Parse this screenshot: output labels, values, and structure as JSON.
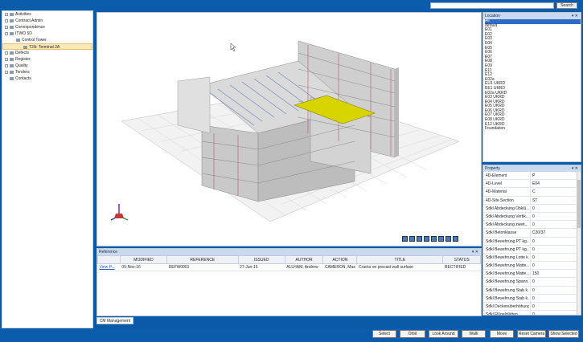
{
  "search": {
    "button": "Search",
    "value": ""
  },
  "tree": [
    {
      "label": "Activities",
      "level": 0
    },
    {
      "label": "Contract Admin",
      "level": 0
    },
    {
      "label": "Correspondence",
      "level": 0
    },
    {
      "label": "ITWO 5D",
      "level": 0
    },
    {
      "label": "Control Tower",
      "level": 1
    },
    {
      "label": "T2A: Terminal 2A",
      "level": 2,
      "selected": true
    },
    {
      "label": "Defects",
      "level": 0
    },
    {
      "label": "Register",
      "level": 0
    },
    {
      "label": "Quality",
      "level": 0
    },
    {
      "label": "Tenders",
      "level": 0
    },
    {
      "label": "Contacts",
      "level": 0
    }
  ],
  "location": {
    "title": "Location",
    "items": [
      "All",
      "default",
      "E01",
      "E02",
      "E03",
      "E04",
      "E05",
      "E06",
      "E07",
      "E08",
      "E09",
      "E11",
      "E12",
      "E02a",
      "EU1 UKRD",
      "EE1 UKRD",
      "E02a UKRD",
      "E03 UKRD",
      "E04 UKRD",
      "E05 UKRD",
      "E06 UKRD",
      "E07 UKRD",
      "E08 UKRD",
      "E12 UKRD",
      "Foundation"
    ],
    "selected": "All"
  },
  "property": {
    "title": "Property",
    "rows": [
      {
        "k": "4D-Element",
        "v": "P"
      },
      {
        "k": "4D-Level",
        "v": "E04"
      },
      {
        "k": "4D-Material",
        "v": "C"
      },
      {
        "k": "4D-Site Section",
        "v": "ST"
      },
      {
        "k": "Sdkl Abdeckung Obklü...",
        "v": "0"
      },
      {
        "k": "Sdkl Abdeckung Vertik...",
        "v": "0"
      },
      {
        "k": "Sdkl Abdeckung zweit...",
        "v": "0"
      },
      {
        "k": "Sdkl Betonklasse",
        "v": "C30/37"
      },
      {
        "k": "Sdkl Bewehrung PT kg...",
        "v": "0"
      },
      {
        "k": "Sdkl Bewehrung PT kg...",
        "v": "0"
      },
      {
        "k": "Sdkl Bewehrung Lotte k...",
        "v": "0"
      },
      {
        "k": "Sdkl Bewehrung Matte...",
        "v": "0"
      },
      {
        "k": "Sdkl Bewehrung Matte...",
        "v": "150"
      },
      {
        "k": "Sdkl Bewehrung Spann...",
        "v": "0"
      },
      {
        "k": "Sdkl Bewehrung Stab k...",
        "v": "0"
      },
      {
        "k": "Sdkl Bewehrung Stab k...",
        "v": "0"
      },
      {
        "k": "Sdkl Deckenüberhöhung",
        "v": "0"
      },
      {
        "k": "Sdkl Flügelglätten",
        "v": "0"
      }
    ]
  },
  "reference": {
    "title": "Reference",
    "columns": [
      "",
      "MODIFIED",
      "REFERENCE",
      "ISSUED",
      "AUTHOR",
      "ACTION",
      "TITLE",
      "STATUS"
    ],
    "rows": [
      {
        "link": "View P...",
        "modified": "05-Nov-16",
        "reference": "DEFW0001",
        "issued": "27-Jun-15",
        "author": "ALLHAM, Andrew",
        "action": "CAMERON, Max",
        "title": "Cracks on precast wall surface",
        "status": "RECTIFIED"
      }
    ]
  },
  "cm_tab": "CM Management",
  "buttons": [
    "Select",
    "Orbit",
    "Look Around",
    "Walk",
    "Move",
    "Reset Camera",
    "Show Selected"
  ],
  "colors": {
    "highlight": "#d8d400",
    "accent": "#0b5cab"
  }
}
